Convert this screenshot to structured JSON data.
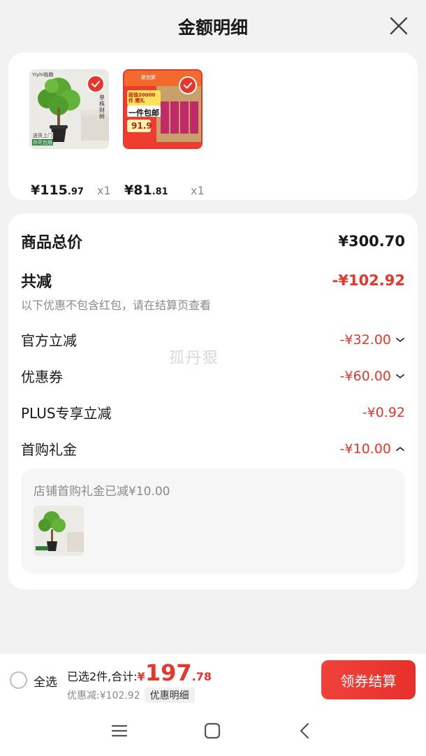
{
  "header": {
    "title": "金额明细",
    "close_icon": "close-icon"
  },
  "products": [
    {
      "name": "fortune-tree-plant",
      "price_int": "¥115",
      "price_dec": ".97",
      "qty": "x1",
      "thumb_text": {
        "brand": "Yiyhi植趣",
        "promo1": "送货上门",
        "promo2": "存死包赔",
        "side": "单株财树"
      }
    },
    {
      "name": "snack-gift-box",
      "price_int": "¥81",
      "price_dec": ".81",
      "qty": "x1",
      "thumb_text": {
        "top": "聚划算",
        "promo": "一件包邮",
        "price": "91.9",
        "banner": "超值20000件 赠礼"
      }
    }
  ],
  "detail": {
    "total": {
      "label": "商品总价",
      "value": "¥300.70"
    },
    "discount": {
      "label": "共减",
      "value": "-¥102.92",
      "note": "以下优惠不包含红包，请在结算页查看"
    },
    "items": [
      {
        "label": "官方立减",
        "value": "-¥32.00",
        "chevron": "chevron-down-icon"
      },
      {
        "label": "优惠券",
        "value": "-¥60.00",
        "chevron": "chevron-down-icon"
      },
      {
        "label": "PLUS专享立减",
        "value": "-¥0.92",
        "chevron": ""
      },
      {
        "label": "首购礼金",
        "value": "-¥10.00",
        "chevron": "chevron-up-icon"
      }
    ],
    "sub": {
      "text": "店铺首购礼金已减¥10.00"
    }
  },
  "watermark": "孤丹狠",
  "bottom": {
    "select_all": "全选",
    "selected": "已选2件,合计:",
    "total_cur": "¥",
    "total_int": "197",
    "total_dec": ".78",
    "discount_text": "优惠减:¥102.92",
    "detail_btn": "优惠明细",
    "checkout": "领券结算"
  },
  "colors": {
    "accent": "#e8362c",
    "background": "#f2f2f2",
    "card": "#ffffff"
  },
  "navbar": {
    "icons": [
      "menu-icon",
      "home-icon",
      "back-icon"
    ]
  }
}
